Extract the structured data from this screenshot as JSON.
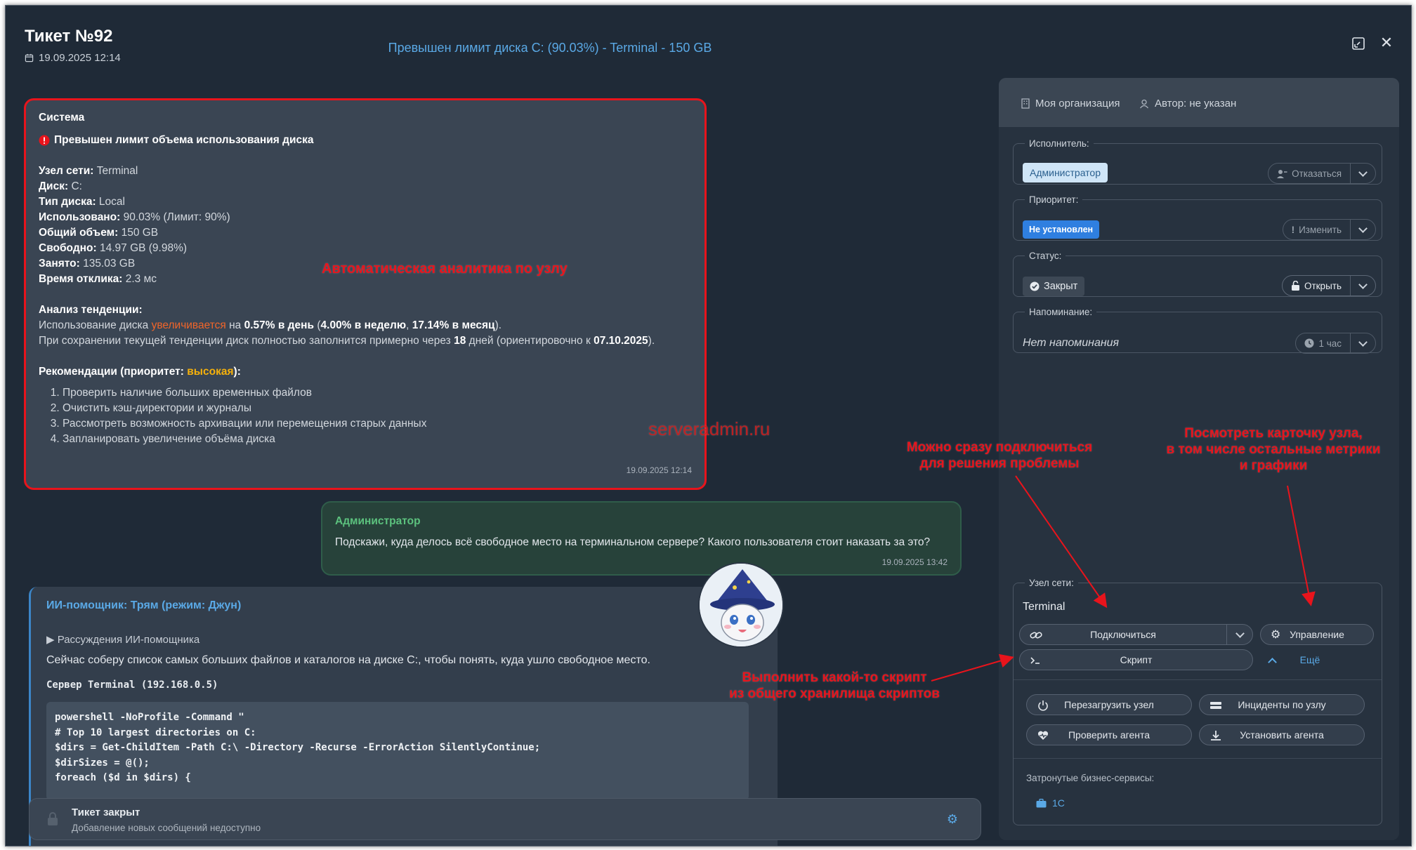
{
  "header": {
    "title": "Тикет №92",
    "date": "19.09.2025 12:14",
    "subject": "Превышен лимит диска C: (90.03%) - Terminal - 150 GB"
  },
  "system_message": {
    "author": "Система",
    "alert": "Превышен лимит объема использования диска",
    "fields": [
      {
        "label": "Узел сети:",
        "value": "Terminal"
      },
      {
        "label": "Диск:",
        "value": "C:"
      },
      {
        "label": "Тип диска:",
        "value": "Local"
      },
      {
        "label": "Использовано:",
        "value": "90.03% (Лимит: 90%)"
      },
      {
        "label": "Общий объем:",
        "value": "150 GB"
      },
      {
        "label": "Свободно:",
        "value": "14.97 GB (9.98%)"
      },
      {
        "label": "Занято:",
        "value": "135.03 GB"
      },
      {
        "label": "Время отклика:",
        "value": "2.3 мс"
      }
    ],
    "trend_title": "Анализ тенденции:",
    "trend_prefix": "Использование диска ",
    "trend_word": "увеличивается",
    "trend_mid": " на ",
    "trend_day": "0.57% в день",
    "trend_open": " (",
    "trend_week": "4.00% в неделю",
    "trend_comma": ", ",
    "trend_month": "17.14% в месяц",
    "trend_close": ").",
    "forecast_prefix": "При сохранении текущей тенденции диск полностью заполнится примерно через ",
    "forecast_days": "18",
    "forecast_mid": " дней (ориентировочно к ",
    "forecast_date": "07.10.2025",
    "forecast_close": ").",
    "rec_title": "Рекомендации (приоритет: ",
    "rec_priority": "высокая",
    "rec_close": "):",
    "recommendations": [
      "Проверить наличие больших временных файлов",
      "Очистить кэш-директории и журналы",
      "Рассмотреть возможность архивации или перемещения старых данных",
      "Запланировать увеличение объёма диска"
    ],
    "timestamp": "19.09.2025 12:14"
  },
  "admin_message": {
    "author": "Администратор",
    "text": "Подскажи, куда делось всё свободное место на терминальном сервере? Какого пользователя стоит наказать за это?",
    "timestamp": "19.09.2025 13:42"
  },
  "ai_message": {
    "author": "ИИ-помощник: Трям (режим: Джун)",
    "reasoning": "▶ Рассуждения ИИ-помощника",
    "text": "Сейчас соберу список самых больших файлов и каталогов на диске C:, чтобы понять, куда ушло свободное место.",
    "server": "Сервер Terminal (192.168.0.5)",
    "code": "powershell -NoProfile -Command \"\n# Top 10 largest directories on C:\n$dirs = Get-ChildItem -Path C:\\ -Directory -Recurse -ErrorAction SilentlyContinue;\n$dirSizes = @();\nforeach ($d in $dirs) {"
  },
  "closed_bar": {
    "title": "Тикет закрыт",
    "subtitle": "Добавление новых сообщений недоступно"
  },
  "panel": {
    "org": "Моя организация",
    "author": "Автор: не указан",
    "executor": {
      "legend": "Исполнитель:",
      "value": "Администратор",
      "action": "Отказаться"
    },
    "priority": {
      "legend": "Приоритет:",
      "value": "Не установлен",
      "action": "Изменить"
    },
    "status": {
      "legend": "Статус:",
      "value": "Закрыт",
      "action": "Открыть"
    },
    "reminder": {
      "legend": "Напоминание:",
      "value": "Нет напоминания",
      "action": "1 час"
    },
    "node": {
      "legend": "Узел сети:",
      "name": "Terminal",
      "connect": "Подключиться",
      "manage": "Управление",
      "script": "Скрипт",
      "more": "Ещё",
      "reboot": "Перезагрузить узел",
      "incidents": "Инциденты по узлу",
      "check_agent": "Проверить агента",
      "install_agent": "Установить агента",
      "biz_label": "Затронутые бизнес-сервисы:",
      "biz_item": "1С"
    }
  },
  "annotations": {
    "watermark": "serveradmin.ru",
    "analytics": "Автоматическая аналитика по узлу",
    "connect": "Можно сразу подключиться\nдля решения проблемы",
    "card": "Посмотреть карточку узла,\nв том числе остальные метрики\nи графики",
    "script": "Выполнить какой-то скрипт\nиз общего хранилища скриптов"
  },
  "colors": {
    "background": "#1f2a37",
    "accent_blue": "#5aa9e6",
    "annotation_red": "#e8141c",
    "admin_green": "#5cc27e",
    "priority_blue": "#2f7fe0"
  }
}
